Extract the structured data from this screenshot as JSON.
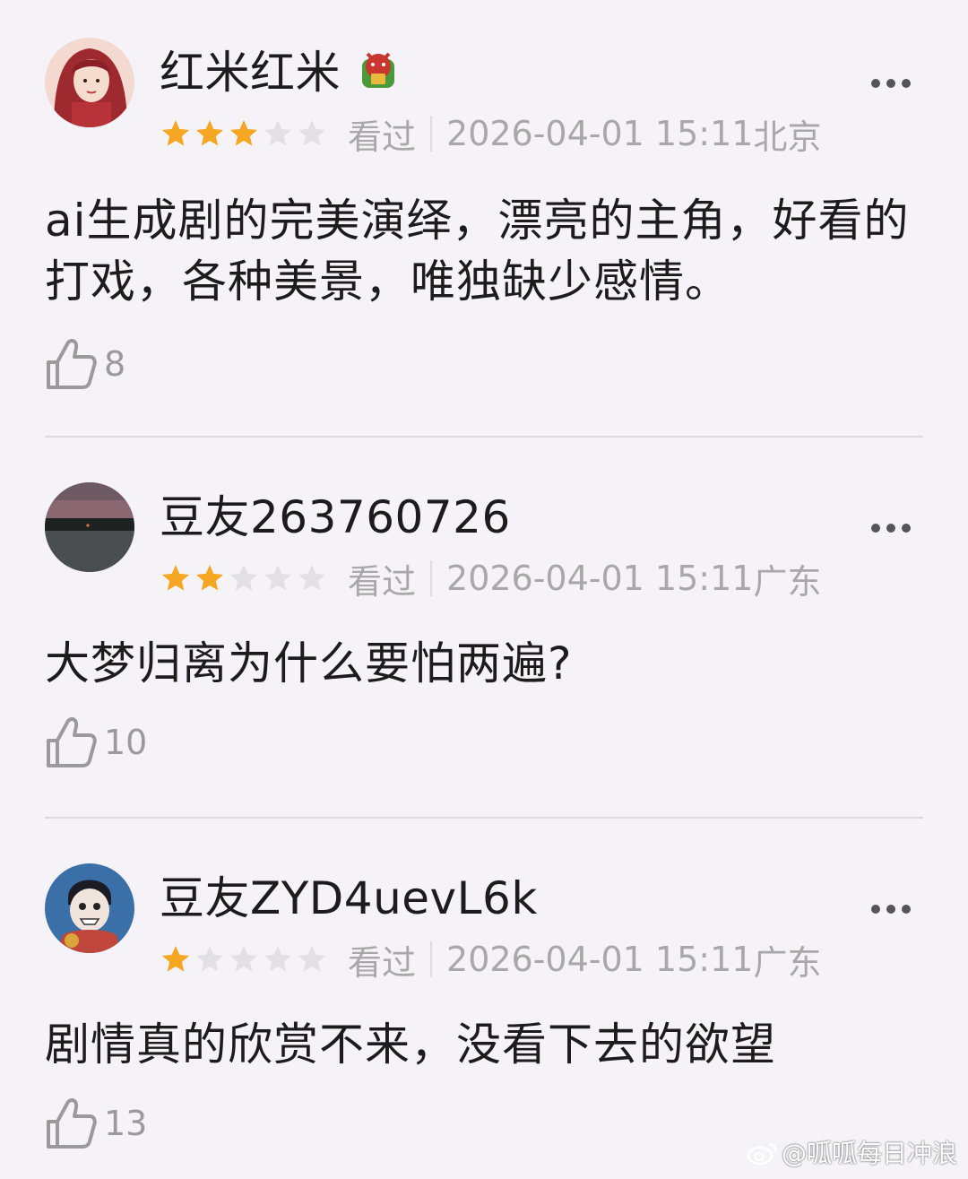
{
  "reviews": [
    {
      "username": "红米红米",
      "rating": 3,
      "watched_label": "看过",
      "timestamp": "2026-04-01 15:11",
      "location": "北京",
      "content": "ai生成剧的完美演绎，漂亮的主角，好看的打戏，各种美景，唯独缺少感情。",
      "likes": "8"
    },
    {
      "username": "豆友263760726",
      "rating": 2,
      "watched_label": "看过",
      "timestamp": "2026-04-01 15:11",
      "location": "广东",
      "content": "大梦归离为什么要怕两遍?",
      "likes": "10"
    },
    {
      "username": "豆友ZYD4uevL6k",
      "rating": 1,
      "watched_label": "看过",
      "timestamp": "2026-04-01 15:11",
      "location": "广东",
      "content": "剧情真的欣赏不来，没看下去的欲望",
      "likes": "13"
    }
  ],
  "colors": {
    "star_filled": "#f5a623",
    "star_empty": "#e2e0e4",
    "background": "#f5f3f8"
  },
  "icons": [
    "thumbs-up-icon",
    "more-dots-icon",
    "star-icon",
    "weibo-icon"
  ],
  "watermark": "@呱呱每日冲浪"
}
